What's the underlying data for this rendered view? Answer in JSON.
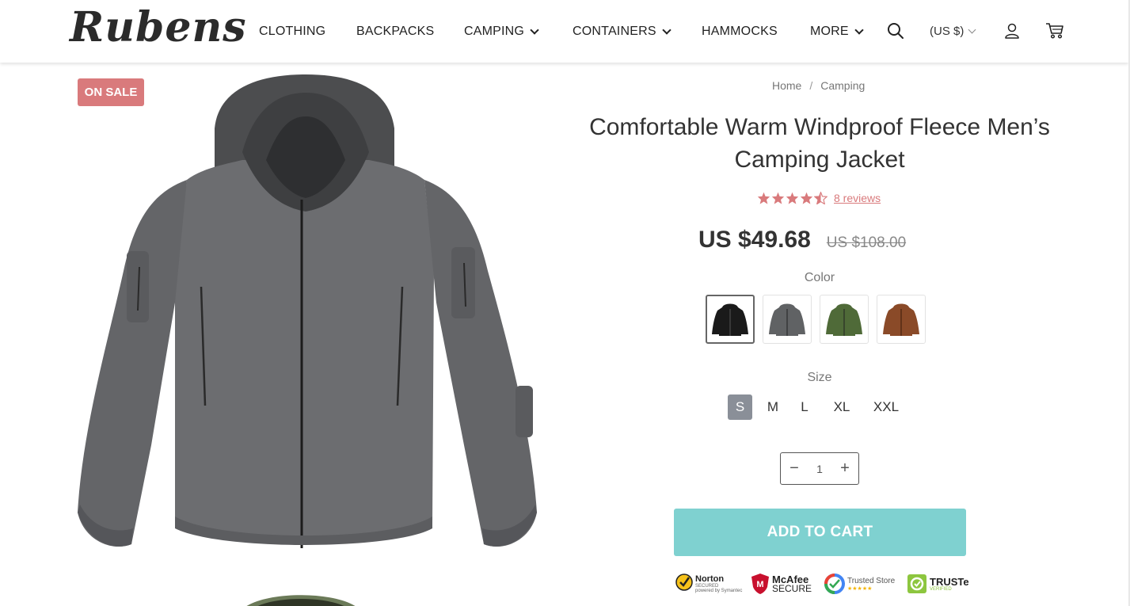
{
  "brand": {
    "logo_text": "Rubens"
  },
  "nav": {
    "items": [
      {
        "label": "CLOTHING",
        "has_dropdown": false
      },
      {
        "label": "BACKPACKS",
        "has_dropdown": false
      },
      {
        "label": "CAMPING",
        "has_dropdown": true
      },
      {
        "label": "CONTAINERS",
        "has_dropdown": true
      },
      {
        "label": "HAMMOCKS",
        "has_dropdown": false
      },
      {
        "label": "MORE",
        "has_dropdown": true
      }
    ],
    "currency": "(US $)",
    "icons": [
      "search-icon",
      "user-icon",
      "cart-icon"
    ]
  },
  "product": {
    "badge": "ON SALE",
    "breadcrumb": [
      "Home",
      "Camping"
    ],
    "breadcrumb_sep": "/",
    "title": "Comfortable Warm Windproof Fleece Men’s Camping Jacket",
    "rating": 4.5,
    "reviews_label": "8 reviews",
    "price": "US $49.68",
    "old_price": "US $108.00",
    "color_label": "Color",
    "colors": [
      {
        "name": "black",
        "hex": "#1a1a1a",
        "selected": true
      },
      {
        "name": "gray",
        "hex": "#606264",
        "selected": false
      },
      {
        "name": "green",
        "hex": "#4f6a38",
        "selected": false
      },
      {
        "name": "brown",
        "hex": "#8a4a28",
        "selected": false
      }
    ],
    "size_label": "Size",
    "sizes": [
      {
        "label": "S",
        "selected": true
      },
      {
        "label": "M",
        "selected": false
      },
      {
        "label": "L",
        "selected": false
      },
      {
        "label": "XL",
        "selected": false
      },
      {
        "label": "XXL",
        "selected": false
      }
    ],
    "quantity": "1",
    "qty_minus": "−",
    "qty_plus": "+",
    "add_to_cart": "ADD TO CART"
  },
  "trust_badges": [
    {
      "name": "Norton",
      "line1": "Norton",
      "line2": "SECURED",
      "line3": "powered by Symantec"
    },
    {
      "name": "McAfee",
      "line1": "McAfee",
      "line2": "SECURE"
    },
    {
      "name": "Trusted Store",
      "line1": "Trusted Store"
    },
    {
      "name": "TRUSTe",
      "line1": "TRUSTe",
      "line2": "VERIFIED"
    }
  ],
  "colors": {
    "accent": "#d97a7c",
    "button": "#7fd1d0",
    "size_selected": "#8a8f98"
  }
}
